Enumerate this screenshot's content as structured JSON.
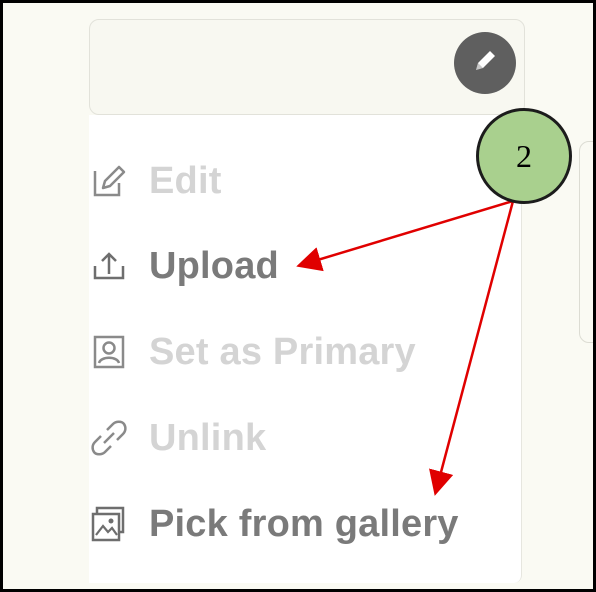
{
  "menu": {
    "items": [
      {
        "label": "Edit",
        "icon": "pencil-square-icon",
        "state": "disabled"
      },
      {
        "label": "Upload",
        "icon": "upload-icon",
        "state": "enabled"
      },
      {
        "label": "Set as Primary",
        "icon": "person-frame-icon",
        "state": "disabled"
      },
      {
        "label": "Unlink",
        "icon": "link-icon",
        "state": "disabled"
      },
      {
        "label": "Pick from gallery",
        "icon": "gallery-icon",
        "state": "enabled"
      }
    ]
  },
  "callout": {
    "label": "2",
    "color": "#a9d08e"
  },
  "arrow_color": "#e00000",
  "fab": {
    "icon": "pencil-icon",
    "color": "#5f5f5f"
  }
}
